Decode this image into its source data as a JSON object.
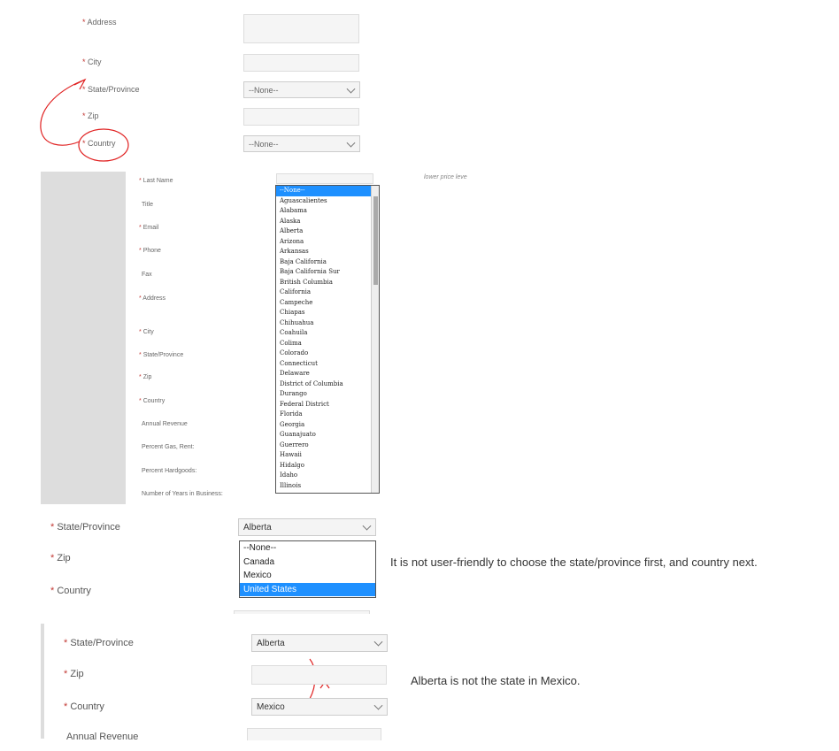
{
  "panel1": {
    "rows": [
      {
        "label": "Address",
        "req": "*"
      },
      {
        "label": "City",
        "req": "*"
      },
      {
        "label": "State/Province",
        "req": "*",
        "value": "--None--"
      },
      {
        "label": "Zip",
        "req": "*"
      },
      {
        "label": "Country",
        "req": "*",
        "value": "--None--"
      }
    ]
  },
  "panel2": {
    "side_note": "lower price leve",
    "labels": [
      {
        "text": "Last Name",
        "req": "*"
      },
      {
        "text": "Title",
        "req": ""
      },
      {
        "text": "Email",
        "req": "*"
      },
      {
        "text": "Phone",
        "req": "*"
      },
      {
        "text": "Fax",
        "req": ""
      },
      {
        "text": "Address",
        "req": "*"
      },
      {
        "text": "City",
        "req": "*"
      },
      {
        "text": "State/Province",
        "req": "*"
      },
      {
        "text": "Zip",
        "req": "*"
      },
      {
        "text": "Country",
        "req": "*"
      },
      {
        "text": "Annual Revenue",
        "req": ""
      },
      {
        "text": "Percent Gas, Rent:",
        "req": ""
      },
      {
        "text": "Percent Hardgoods:",
        "req": ""
      },
      {
        "text": "Number of Years in Business:",
        "req": ""
      }
    ],
    "options": [
      "--None--",
      "Aguascalientes",
      "Alabama",
      "Alaska",
      "Alberta",
      "Arizona",
      "Arkansas",
      "Baja California",
      "Baja California Sur",
      "British Columbia",
      "California",
      "Campeche",
      "Chiapas",
      "Chihuahua",
      "Coahuila",
      "Colima",
      "Colorado",
      "Connecticut",
      "Delaware",
      "District of Columbia",
      "Durango",
      "Federal District",
      "Florida",
      "Georgia",
      "Guanajuato",
      "Guerrero",
      "Hawaii",
      "Hidalgo",
      "Idaho",
      "Illinois"
    ],
    "selected_option": "--None--"
  },
  "panel3": {
    "state_label": "State/Province",
    "zip_label": "Zip",
    "country_label": "Country",
    "req": "*",
    "state_value": "Alberta",
    "country_options": [
      "--None--",
      "Canada",
      "Mexico",
      "United States"
    ],
    "selected_country": "United States",
    "note": "It is not user-friendly to choose the state/province first, and country next."
  },
  "panel4": {
    "state_label": "State/Province",
    "zip_label": "Zip",
    "country_label": "Country",
    "revenue_label": "Annual Revenue",
    "req": "*",
    "state_value": "Alberta",
    "country_value": "Mexico",
    "note": "Alberta is not the state in Mexico."
  },
  "colors": {
    "required": "#c23934",
    "annotation": "#e02020",
    "highlight": "#1e90ff"
  }
}
